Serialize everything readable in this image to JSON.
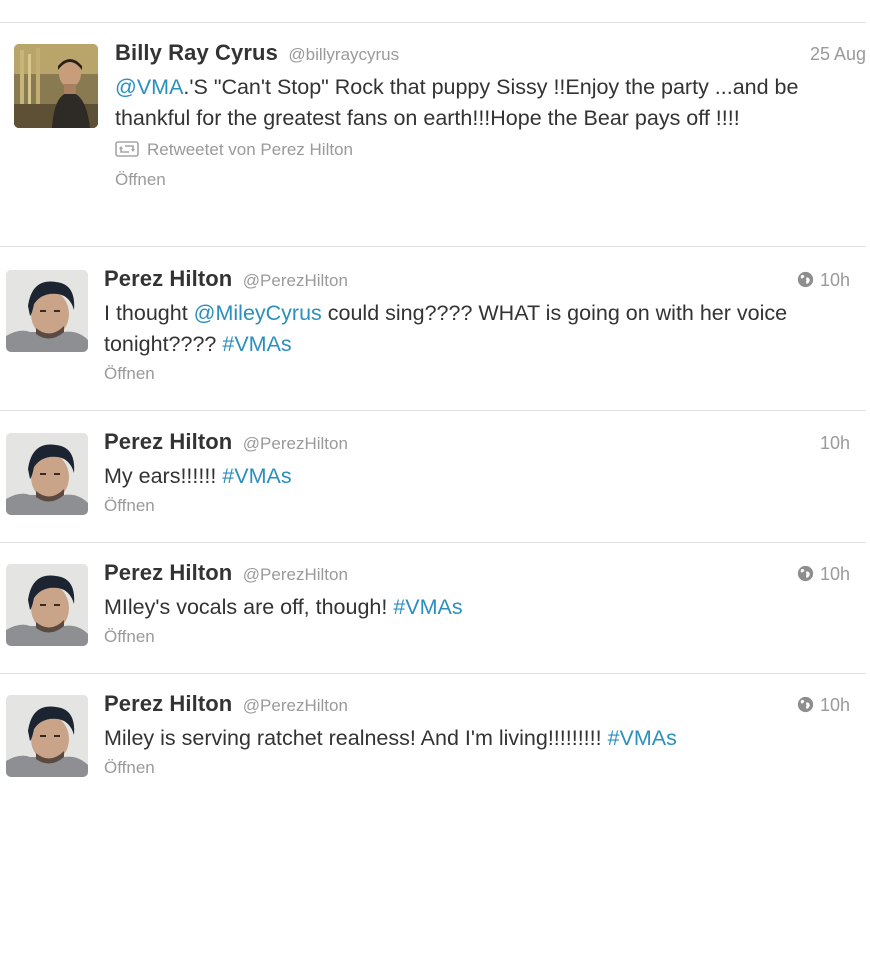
{
  "tweets": [
    {
      "fullname": "Billy Ray Cyrus",
      "username": "@billyraycyrus",
      "time": "25 Aug",
      "text_segments": [
        {
          "type": "link",
          "text": "@VMA"
        },
        {
          "type": "text",
          "text": ".'S \"Can't Stop\" Rock that puppy Sissy !!Enjoy the party ...and be thankful for the greatest fans on earth!!!Hope the Bear pays off !!!!"
        }
      ],
      "retweet_label": "Retweetet von Perez Hilton",
      "open_label": "Öffnen",
      "globe": false
    },
    {
      "fullname": "Perez Hilton",
      "username": "@PerezHilton",
      "time": "10h",
      "text_segments": [
        {
          "type": "text",
          "text": "I thought "
        },
        {
          "type": "link",
          "text": "@MileyCyrus"
        },
        {
          "type": "text",
          "text": " could sing???? WHAT is going on with her voice tonight???? "
        },
        {
          "type": "link",
          "text": "#VMAs"
        }
      ],
      "open_label": "Öffnen",
      "globe": true
    },
    {
      "fullname": "Perez Hilton",
      "username": "@PerezHilton",
      "time": "10h",
      "text_segments": [
        {
          "type": "text",
          "text": "My ears!!!!!! "
        },
        {
          "type": "link",
          "text": "#VMAs"
        }
      ],
      "open_label": "Öffnen",
      "globe": false
    },
    {
      "fullname": "Perez Hilton",
      "username": "@PerezHilton",
      "time": "10h",
      "text_segments": [
        {
          "type": "text",
          "text": "MIley's vocals are off, though! "
        },
        {
          "type": "link",
          "text": "#VMAs"
        }
      ],
      "open_label": "Öffnen",
      "globe": true
    },
    {
      "fullname": "Perez Hilton",
      "username": "@PerezHilton",
      "time": "10h",
      "text_segments": [
        {
          "type": "text",
          "text": "Miley is serving ratchet realness! And I'm living!!!!!!!!! "
        },
        {
          "type": "link",
          "text": "#VMAs"
        }
      ],
      "open_label": "Öffnen",
      "globe": true
    }
  ],
  "colors": {
    "link": "#2a8fbd",
    "meta": "#9a9a9a",
    "text": "#333333",
    "divider": "#e3e3e3"
  },
  "icons": {
    "globe": "globe-icon",
    "retweet": "retweet-icon"
  }
}
